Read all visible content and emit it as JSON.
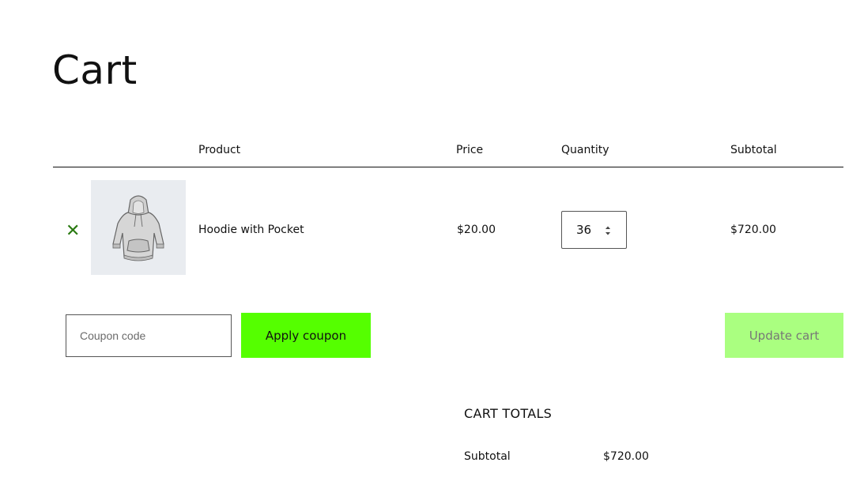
{
  "page": {
    "title": "Cart"
  },
  "table": {
    "headers": {
      "product": "Product",
      "price": "Price",
      "quantity": "Quantity",
      "subtotal": "Subtotal"
    },
    "rows": [
      {
        "remove_icon": "close-icon",
        "remove_glyph": "✕",
        "thumbnail_icon": "hoodie-image",
        "product": "Hoodie with Pocket",
        "price": "$20.00",
        "quantity": "36",
        "subtotal": "$720.00"
      }
    ]
  },
  "actions": {
    "coupon_placeholder": "Coupon code",
    "apply_label": "Apply coupon",
    "update_label": "Update cart"
  },
  "totals": {
    "title": "CART TOTALS",
    "subtotal_label": "Subtotal",
    "subtotal_value": "$720.00"
  },
  "colors": {
    "apply_button": "#55ff00",
    "update_button_disabled": "#aaff80",
    "remove_icon": "#2a7a12",
    "thumbnail_bg": "#e9ecf0"
  }
}
